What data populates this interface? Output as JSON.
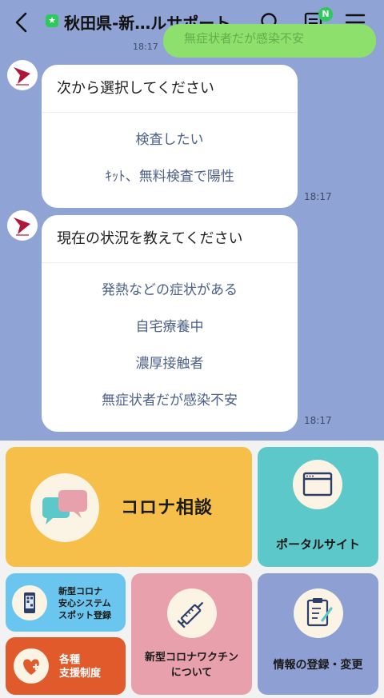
{
  "header": {
    "title": "秋田県-新…ルサポート",
    "notes_badge": "N",
    "official_mark": "★"
  },
  "previous_message": {
    "text": "無症状者だが感染不安",
    "time": "18:17"
  },
  "messages": [
    {
      "title": "次から選択してください",
      "options": [
        "検査したい",
        "ｷｯﾄ、無料検査で陽性"
      ],
      "time": "18:17"
    },
    {
      "title": "現在の状況を教えてください",
      "options": [
        "発熱などの症状がある",
        "自宅療養中",
        "濃厚接触者",
        "無症状者だが感染不安"
      ],
      "time": "18:17"
    }
  ],
  "rich_menu": {
    "consult": "コロナ相談",
    "portal": "ポータルサイト",
    "anshin_line1": "新型コロナ",
    "anshin_line2": "安心システム",
    "anshin_line3": "スポット登録",
    "support_line1": "各種",
    "support_line2": "支援制度",
    "vaccine_line1": "新型コロナワクチン",
    "vaccine_line2": "について",
    "register": "情報の登録・変更"
  },
  "colors": {
    "chat_background": "#8fa3d4",
    "consult_tile": "#f6bf4a",
    "portal_tile": "#5cc8c9",
    "anshin_tile": "#6ac6ee",
    "support_tile": "#e05a2c",
    "vaccine_tile": "#e8a0ac",
    "register_tile": "#8e9fd4",
    "option_text": "#4d6189"
  }
}
